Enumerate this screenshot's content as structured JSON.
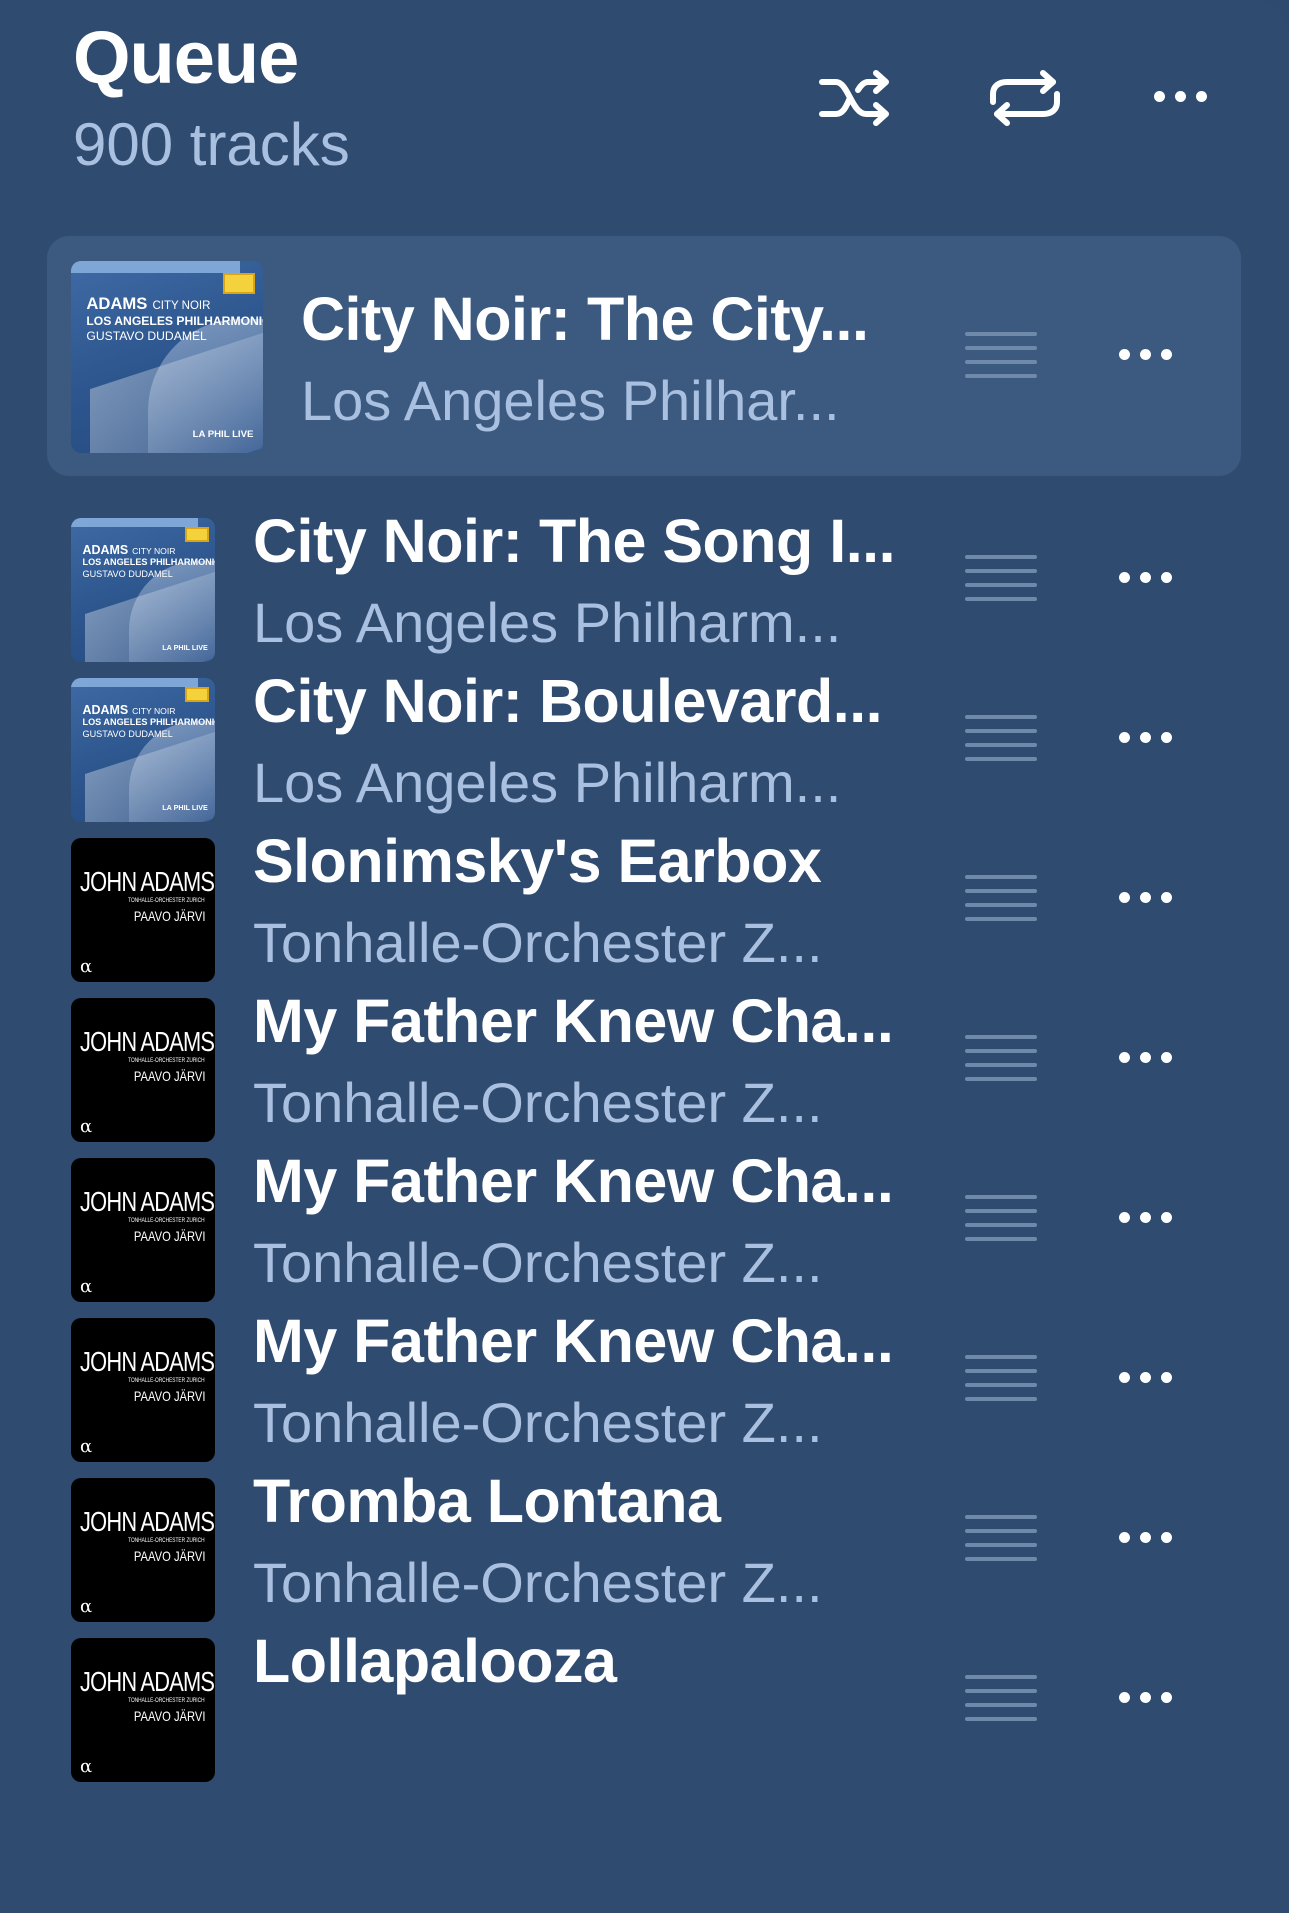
{
  "header": {
    "title": "Queue",
    "track_count": "900 tracks",
    "icons": [
      "shuffle-icon",
      "repeat-icon",
      "more-icon"
    ]
  },
  "colors": {
    "background": "#2f4b6f",
    "current_row": "#3c5a80",
    "title_text": "#ffffff",
    "secondary_text": "#a9c0e0",
    "handle": "#6f89ab"
  },
  "artwork": {
    "dg": {
      "line1": "ADAMS",
      "line1b": "CITY NOIR",
      "line2": "LOS ANGELES PHILHARMONIC",
      "line3": "GUSTAVO DUDAMEL",
      "logo": "LA PHIL LIVE"
    },
    "ja": {
      "name": "JOHN ADAMS",
      "orchestra": "TONHALLE-ORCHESTER ZÜRICH",
      "conductor": "PAAVO JÄRVI",
      "label": "α"
    }
  },
  "tracks": [
    {
      "title": "City Noir: The City...",
      "artist": "Los Angeles Philhar...",
      "artwork": "dg",
      "current": true
    },
    {
      "title": "City Noir: The Song I...",
      "artist": "Los Angeles Philharm...",
      "artwork": "dg",
      "current": false
    },
    {
      "title": "City Noir: Boulevard...",
      "artist": "Los Angeles Philharm...",
      "artwork": "dg",
      "current": false
    },
    {
      "title": "Slonimsky's Earbox",
      "artist": "Tonhalle-Orchester Z...",
      "artwork": "ja",
      "current": false
    },
    {
      "title": "My Father Knew Cha...",
      "artist": "Tonhalle-Orchester Z...",
      "artwork": "ja",
      "current": false
    },
    {
      "title": "My Father Knew Cha...",
      "artist": "Tonhalle-Orchester Z...",
      "artwork": "ja",
      "current": false
    },
    {
      "title": "My Father Knew Cha...",
      "artist": "Tonhalle-Orchester Z...",
      "artwork": "ja",
      "current": false
    },
    {
      "title": "Tromba Lontana",
      "artist": "Tonhalle-Orchester Z...",
      "artwork": "ja",
      "current": false
    },
    {
      "title": "Lollapalooza",
      "artist": "",
      "artwork": "ja",
      "current": false
    }
  ]
}
